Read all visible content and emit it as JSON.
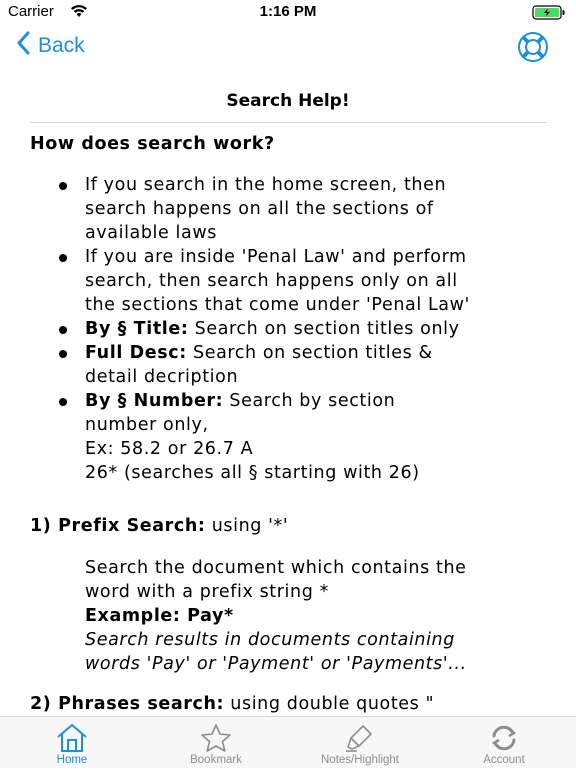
{
  "status_bar": {
    "carrier": "Carrier",
    "time": "1:16 PM"
  },
  "nav": {
    "back_label": "Back"
  },
  "page": {
    "title": "Search Help!",
    "question": "How does search work?",
    "bullets": [
      {
        "bold": "",
        "lines": [
          "If you search in the home screen, then",
          "search happens on all the sections of",
          "available laws"
        ]
      },
      {
        "bold": "",
        "lines": [
          "If you are inside 'Penal Law' and perform",
          "search, then search happens only on all",
          "the sections that come under 'Penal Law'"
        ]
      },
      {
        "bold": "By § Title:",
        "lines": [
          " Search on section titles only"
        ]
      },
      {
        "bold": "Full Desc:",
        "lines": [
          " Search on section titles &",
          "detail decription"
        ]
      },
      {
        "bold": "By § Number:",
        "lines": [
          " Search by section",
          "number only,",
          "Ex: 58.2 or 26.7 A",
          "26* (searches all § starting with 26)"
        ]
      }
    ],
    "prefix": {
      "heading": "1) Prefix Search:",
      "using": " using '*'",
      "desc_line1": "Search the document which contains the",
      "desc_line2": "word with a prefix string *",
      "example": "Example: Pay*",
      "result_line1": "Search results in documents containing",
      "result_line2": "words 'Pay' or 'Payment' or 'Payments'..."
    },
    "phrases": {
      "heading": "2) Phrases search:",
      "using": " using double quotes \""
    }
  },
  "tabs": [
    {
      "label": "Home",
      "icon": "home-icon",
      "active": true
    },
    {
      "label": "Bookmark",
      "icon": "star-icon",
      "active": false
    },
    {
      "label": "Notes/Highlight",
      "icon": "highlighter-icon",
      "active": false
    },
    {
      "label": "Account",
      "icon": "refresh-icon",
      "active": false
    }
  ],
  "colors": {
    "accent": "#1e8fd8",
    "inactive": "#8e8e8e"
  }
}
